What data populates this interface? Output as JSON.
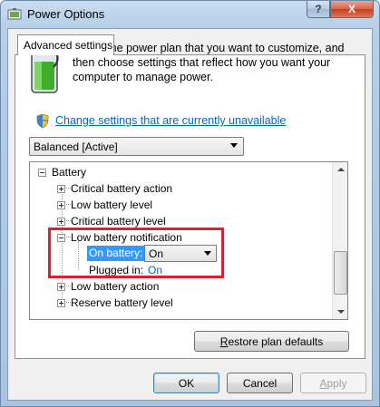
{
  "window": {
    "title": "Power Options",
    "help_glyph": "?",
    "close_glyph": "X"
  },
  "tab": {
    "label": "Advanced settings"
  },
  "intro_text": "Select the power plan that you want to customize, and then choose settings that reflect how you want your computer to manage power.",
  "change_link": "Change settings that are currently unavailable",
  "plan_select": {
    "value": "Balanced [Active]"
  },
  "tree": {
    "root": "Battery",
    "items": [
      {
        "label": "Critical battery action",
        "expanded": false
      },
      {
        "label": "Low battery level",
        "expanded": false
      },
      {
        "label": "Critical battery level",
        "expanded": false
      },
      {
        "label": "Low battery notification",
        "expanded": true
      },
      {
        "label": "Low battery action",
        "expanded": false
      },
      {
        "label": "Reserve battery level",
        "expanded": false
      }
    ],
    "on_battery_label": "On battery:",
    "on_battery_value": "On",
    "plugged_in_label": "Plugged in:",
    "plugged_in_value": "On"
  },
  "buttons": {
    "restore_prefix": "R",
    "restore_rest": "estore plan defaults",
    "ok": "OK",
    "cancel": "Cancel",
    "apply_prefix": "A",
    "apply_rest": "pply"
  },
  "colors": {
    "highlight_border": "#e01e2e",
    "link": "#0066cc",
    "selection": "#3399ff"
  }
}
